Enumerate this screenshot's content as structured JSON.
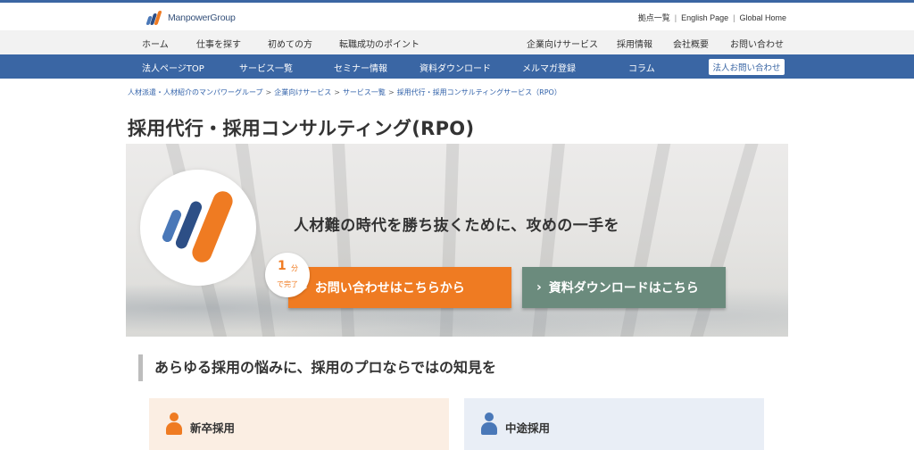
{
  "header": {
    "logo_text": "ManpowerGroup",
    "util_links": [
      "拠点一覧",
      "English Page",
      "Global Home"
    ],
    "separator": "|"
  },
  "nav_primary": [
    "ホーム",
    "仕事を探す",
    "初めての方",
    "転職成功のポイント",
    "企業向けサービス",
    "採用情報",
    "会社概要",
    "お問い合わせ"
  ],
  "nav_corporate": {
    "items": [
      "法人ページTOP",
      "サービス一覧",
      "セミナー情報",
      "資料ダウンロード",
      "メルマガ登録",
      "コラム"
    ],
    "contact_button": "法人お問い合わせ"
  },
  "breadcrumb": [
    "人材派遣・人材紹介のマンパワーグループ",
    "企業向けサービス",
    "サービス一覧",
    "採用代行・採用コンサルティングサービス（RPO）"
  ],
  "breadcrumb_sep": ">",
  "page_title": "採用代行・採用コンサルティング(RPO)",
  "hero": {
    "headline": "人材難の時代を勝ち抜くために、攻めの一手を",
    "badge_number": "1",
    "badge_unit": "分",
    "badge_sub": "で完了",
    "cta_contact": "お問い合わせはこちらから",
    "cta_download": "資料ダウンロードはこちら",
    "chevron": "›"
  },
  "section": {
    "title": "あらゆる採用の悩みに、採用のプロならではの知見を"
  },
  "cards": [
    {
      "label": "新卒採用"
    },
    {
      "label": "中途採用"
    }
  ],
  "colors": {
    "brand_blue": "#3a66a4",
    "accent_orange": "#ef7b22",
    "cta_green": "#6b8b7d",
    "logo_mid_blue": "#4a78b8",
    "logo_dark_blue": "#2d4f86"
  },
  "icons": [
    "manpower-logo-icon",
    "chevron-right-icon",
    "person-icon"
  ]
}
